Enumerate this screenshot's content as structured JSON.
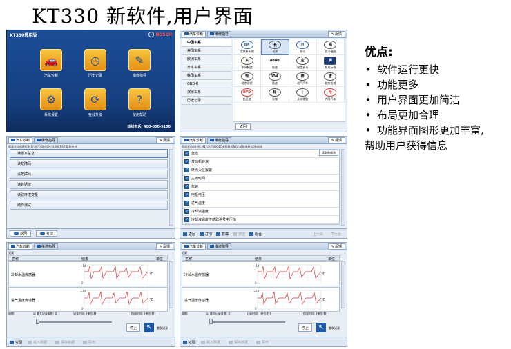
{
  "page": {
    "title": "KT330 新软件,用户界面"
  },
  "home": {
    "title": "KT330通用版",
    "logo_text": "BOSCH",
    "tiles": [
      {
        "label": "汽车诊断",
        "icon": "car-icon"
      },
      {
        "label": "历史记录",
        "icon": "clock-icon"
      },
      {
        "label": "维修指导",
        "icon": "wrench-book-icon"
      },
      {
        "label": "系统设置",
        "icon": "gear-icon"
      },
      {
        "label": "在线升级",
        "icon": "globe-update-icon"
      },
      {
        "label": "使用帮助",
        "icon": "help-book-icon"
      }
    ],
    "hotline": "热线电话: 400-000-5100"
  },
  "tabs": {
    "diag": "汽车诊断",
    "guide": "维修指导",
    "feedback": "反馈"
  },
  "brand_screen": {
    "regions": [
      "中国车系",
      "美国车系",
      "欧洲车系",
      "日本车系",
      "韩国车系",
      "OBD-II",
      "演示车系",
      "历史记录"
    ],
    "brands": [
      {
        "logo": "BX",
        "name": "北京新天地"
      },
      {
        "logo": "长",
        "name": "长安"
      },
      {
        "logo": "H",
        "name": "昌河"
      },
      {
        "logo": "福",
        "name": "北汽福田"
      },
      {
        "logo": "东",
        "name": "东风制造"
      },
      {
        "logo": "oooo",
        "name": "奥迪"
      },
      {
        "logo": "宝",
        "name": "保定长马"
      },
      {
        "logo": "狮",
        "name": "东风标致"
      },
      {
        "logo": "现",
        "name": "北京现代"
      },
      {
        "logo": "VW",
        "name": "奥迪"
      },
      {
        "logo": "奔",
        "name": "北汽汽车"
      },
      {
        "logo": "吉",
        "name": "北京吉普"
      },
      {
        "logo": "BYD",
        "name": "比亚迪"
      },
      {
        "logo": "标",
        "name": "长城"
      },
      {
        "logo": "◊",
        "name": "长丰猎豹"
      },
      {
        "logo": "哈",
        "name": "大雨汽车"
      }
    ],
    "back": "返回"
  },
  "func_screen": {
    "breadcrumb": "帮速发动机(M0,M1)\\北汽\\BOSCH/阿歇(ENG)\\帮助系统",
    "items": [
      "读版本信息",
      "读故障码",
      "清故障码",
      "读数据流",
      "读取环境变量",
      "动作测试"
    ],
    "back": "返回",
    "print": "打印"
  },
  "stream_screen": {
    "breadcrumb": "帮速发动机(M0,M1)\\北汽\\BOSCH/阿歇(ENG)\\帮助系统\\读数据流",
    "select_all": "全选",
    "read_btn": "读取数据流",
    "items": [
      "发动机转速",
      "终点火位报警",
      "主喷时间",
      "车速",
      "电瓶电压",
      "进气温度",
      "冷却液温度",
      "冷却液温度传感器信号电压值"
    ],
    "toolbar": {
      "back": "返回",
      "print": "打印",
      "record": "暂停",
      "wave": "波选",
      "combine": "组合",
      "prev": "上一页",
      "next": "下一页"
    }
  },
  "graph_screen": {
    "record_label": "记录",
    "headers": {
      "name": "名称",
      "value": "结果",
      "unit": "单位"
    },
    "rows": [
      {
        "name": "冷却水温传感器",
        "unit": "℃",
        "top": "~14",
        "bottom": "0"
      },
      {
        "name": "进气温度传感器",
        "unit": "℃",
        "top": "~14",
        "bottom": "0"
      }
    ],
    "cycle_label": "周期:",
    "max_records_label": "最大记录条数:",
    "max_records_value": "0",
    "record_time_label": "记录时间:",
    "record_unit_label": "(单位:秒)",
    "hold_time_label": "保留时间:",
    "stop": "停止",
    "cap": "触发记录",
    "toolbar": {
      "back": "返回",
      "load": "载入数据",
      "save": "保存数据",
      "export": "导出"
    }
  },
  "advantages": {
    "heading": "优点:",
    "items": [
      "软件运行更快",
      "功能更多",
      "用户界面更加简洁",
      "布局更加合理",
      "功能界面图形更加丰富,"
    ],
    "continuation": "帮助用户获得信息"
  },
  "colors": {
    "home_bg": "#1c4d97",
    "tile_gold": "#f2a82a",
    "accent_blue": "#2a63b0",
    "trace_red": "#d93a3a"
  }
}
